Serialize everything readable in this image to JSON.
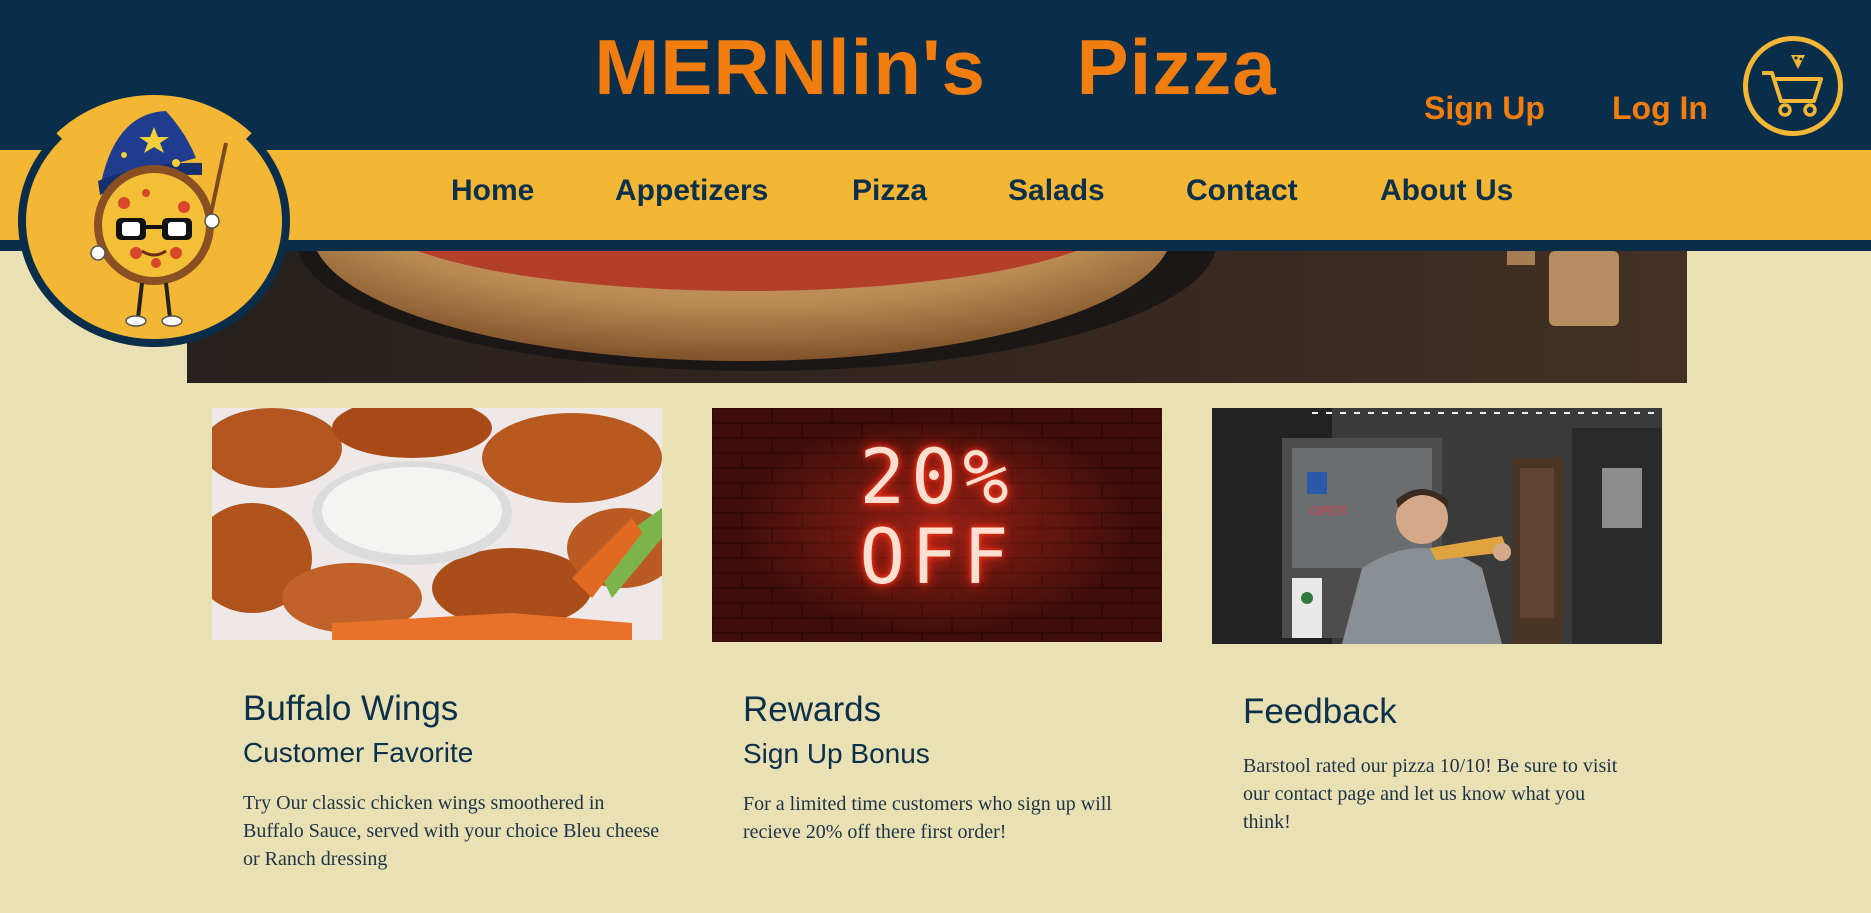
{
  "header": {
    "title": "MERNlin's    Pizza",
    "signup_label": "Sign Up",
    "login_label": "Log In",
    "cart_icon": "shopping-cart-icon"
  },
  "nav": {
    "items": [
      {
        "label": "Home"
      },
      {
        "label": "Appetizers"
      },
      {
        "label": "Pizza"
      },
      {
        "label": "Salads"
      },
      {
        "label": "Contact"
      },
      {
        "label": "About Us"
      }
    ]
  },
  "logo": {
    "description_icon": "wizard-pizza-mascot"
  },
  "cards": [
    {
      "title": "Buffalo Wings",
      "subtitle": "Customer Favorite",
      "text": "Try Our classic chicken wings smoothered in Buffalo Sauce, served with your choice Bleu cheese or Ranch dressing"
    },
    {
      "title": "Rewards",
      "subtitle": "Sign Up Bonus",
      "text": "For a limited time customers who sign up will recieve 20% off there first order!",
      "image_line1": "20%",
      "image_line2": "OFF"
    },
    {
      "title": "Feedback",
      "text": "Barstool rated our pizza 10/10! Be sure to visit our contact page and let us know what you think!",
      "image_sign": "OPEN"
    }
  ],
  "colors": {
    "navy": "#0a2e4a",
    "orange": "#f07d0e",
    "gold": "#f3b735",
    "cream": "#e9e0b4"
  }
}
